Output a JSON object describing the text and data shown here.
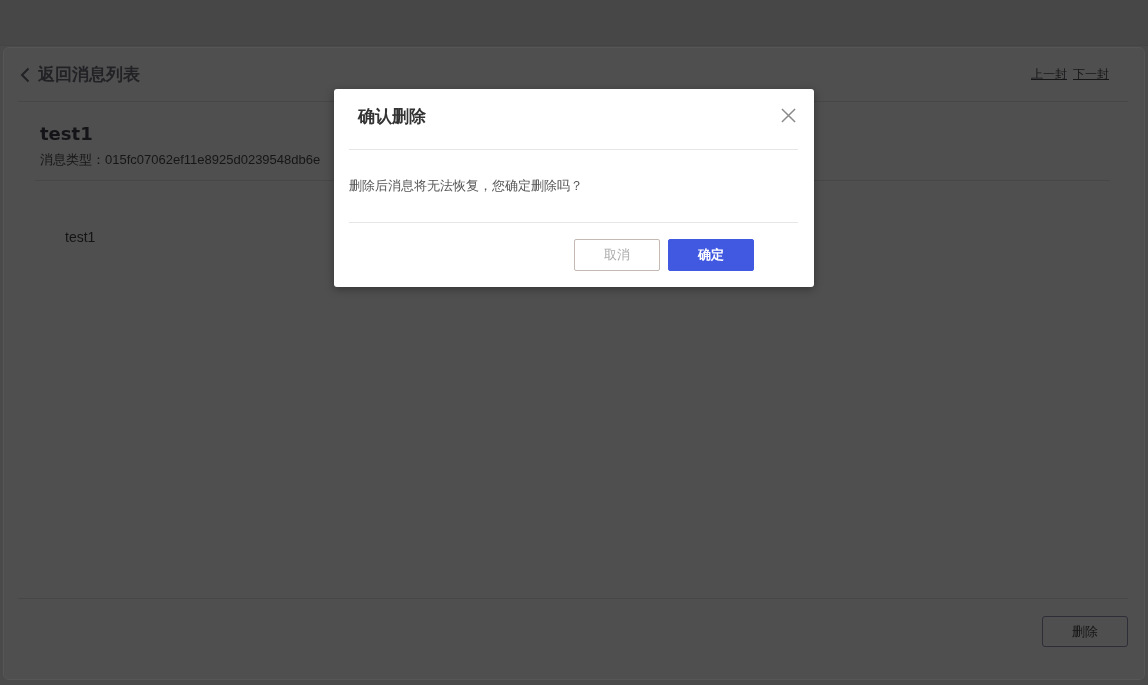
{
  "page": {
    "back_link": {
      "label": "返回消息列表"
    },
    "nav_links": [
      {
        "label": "上一封"
      },
      {
        "label": "下一封"
      }
    ],
    "message": {
      "title": "test1",
      "meta": "消息类型：015fc07062ef11e8925d0239548db6e",
      "body": "test1"
    },
    "delete_button": {
      "label": "删除"
    }
  },
  "dialog": {
    "title": "确认删除",
    "text": "删除后消息将无法恢复，您确定删除吗？",
    "buttons": [
      {
        "label": "取消",
        "kind": "secondary"
      },
      {
        "label": "确定",
        "kind": "primary"
      }
    ]
  }
}
